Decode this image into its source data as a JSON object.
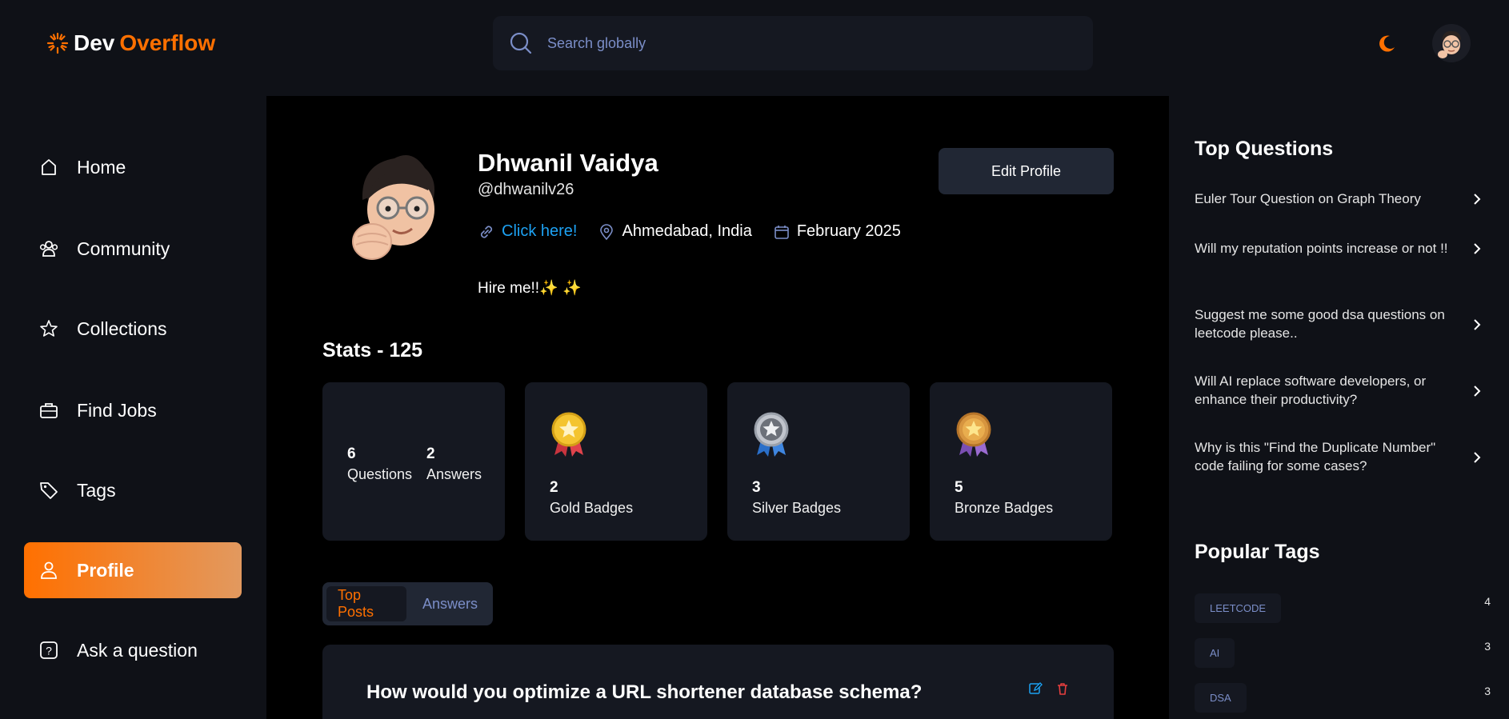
{
  "brand": {
    "part1": "Dev",
    "part2": "Overflow",
    "accent": "#ff7000"
  },
  "search": {
    "placeholder": "Search globally"
  },
  "sidebar": {
    "items": [
      {
        "label": "Home",
        "icon": "home-icon"
      },
      {
        "label": "Community",
        "icon": "users-icon"
      },
      {
        "label": "Collections",
        "icon": "star-icon"
      },
      {
        "label": "Find Jobs",
        "icon": "briefcase-icon"
      },
      {
        "label": "Tags",
        "icon": "tag-icon"
      },
      {
        "label": "Profile",
        "icon": "user-icon",
        "active": true
      },
      {
        "label": "Ask a question",
        "icon": "question-icon"
      }
    ]
  },
  "profile": {
    "name": "Dhwanil Vaidya",
    "username": "@dhwanilv26",
    "portfolio_link": "Click here!",
    "location": "Ahmedabad, India",
    "joined": "February 2025",
    "bio": "Hire me!!✨ ✨",
    "edit_button": "Edit Profile"
  },
  "stats": {
    "title": "Stats - 125",
    "questions": {
      "value": "6",
      "label": "Questions"
    },
    "answers": {
      "value": "2",
      "label": "Answers"
    },
    "gold": {
      "value": "2",
      "label": "Gold Badges",
      "icon": "gold-medal-icon"
    },
    "silver": {
      "value": "3",
      "label": "Silver Badges",
      "icon": "silver-medal-icon"
    },
    "bronze": {
      "value": "5",
      "label": "Bronze Badges",
      "icon": "bronze-medal-icon"
    }
  },
  "tabs": {
    "top_posts": "Top Posts",
    "answers": "Answers"
  },
  "post": {
    "title": "How would you optimize a URL shortener database schema?"
  },
  "right": {
    "top_questions_title": "Top Questions",
    "questions": [
      "Euler Tour Question on Graph Theory",
      "Will my reputation points increase or not !!",
      "Suggest me some good dsa questions on leetcode please..",
      "Will AI replace software developers, or enhance their productivity?",
      "Why is this \"Find the Duplicate Number\" code failing for some cases?"
    ],
    "popular_tags_title": "Popular Tags",
    "tags": [
      {
        "name": "LEETCODE",
        "count": "4"
      },
      {
        "name": "AI",
        "count": "3"
      },
      {
        "name": "DSA",
        "count": "3"
      }
    ]
  }
}
